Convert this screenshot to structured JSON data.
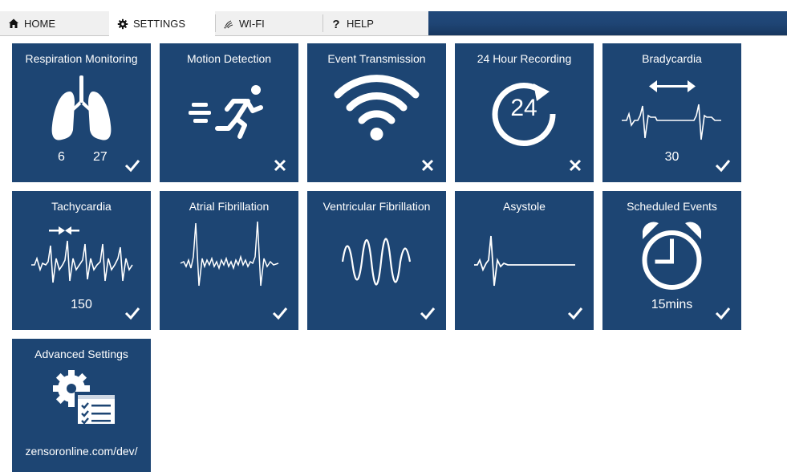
{
  "tabs": {
    "home": {
      "label": "HOME",
      "icon": "house-icon"
    },
    "settings": {
      "label": "SETTINGS",
      "icon": "gear-icon",
      "active": true
    },
    "wifi": {
      "label": "WI-FI",
      "icon": "wifi-icon"
    },
    "help": {
      "label": "HELP",
      "icon": "question-icon"
    }
  },
  "colors": {
    "tile_background": "#1d4573",
    "banner": "#1f4575",
    "tab_background": "#f0f0f0"
  },
  "tiles": {
    "respiration": {
      "title": "Respiration Monitoring",
      "icon": "lungs-icon",
      "value_min": "6",
      "value_max": "27",
      "enabled": true
    },
    "motion": {
      "title": "Motion Detection",
      "icon": "running-person-icon",
      "enabled": false
    },
    "event_transmission": {
      "title": "Event Transmission",
      "icon": "wifi-signal-icon",
      "enabled": false
    },
    "recording": {
      "title": "24 Hour Recording",
      "icon": "24-hour-cycle-icon",
      "icon_text": "24",
      "enabled": false
    },
    "bradycardia": {
      "title": "Bradycardia",
      "icon": "slow-heartbeat-icon",
      "value": "30",
      "enabled": true
    },
    "tachycardia": {
      "title": "Tachycardia",
      "icon": "fast-heartbeat-icon",
      "value": "150",
      "enabled": true
    },
    "atrial_fibrillation": {
      "title": "Atrial Fibrillation",
      "icon": "atrial-fibrillation-ecg-icon",
      "enabled": true
    },
    "ventricular_fibrillation": {
      "title": "Ventricular Fibrillation",
      "icon": "ventricular-fibrillation-wave-icon",
      "enabled": true
    },
    "asystole": {
      "title": "Asystole",
      "icon": "flatline-ecg-icon",
      "enabled": true
    },
    "scheduled_events": {
      "title": "Scheduled Events",
      "icon": "alarm-clock-icon",
      "value": "15mins",
      "enabled": true
    },
    "advanced_settings": {
      "title": "Advanced Settings",
      "icon": "gear-checklist-icon",
      "url": "zensoronline.com/dev/"
    }
  }
}
